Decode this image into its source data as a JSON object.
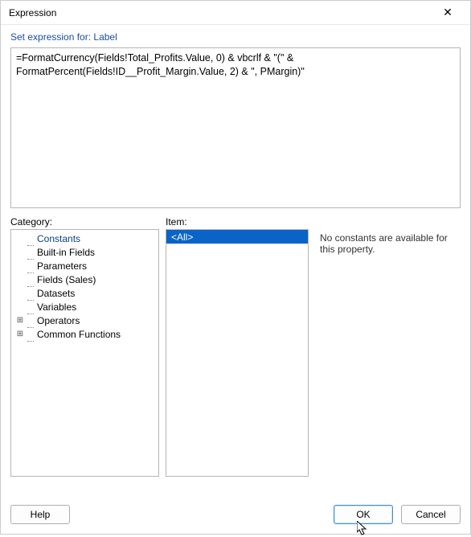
{
  "window": {
    "title": "Expression",
    "close_icon": "✕"
  },
  "header": {
    "prompt_prefix": "Set expression for: ",
    "target": "Label"
  },
  "expression": {
    "text": "=FormatCurrency(Fields!Total_Profits.Value, 0) & vbcrlf & \"(\" & FormatPercent(Fields!ID__Profit_Margin.Value, 2) & \", PMargin)\""
  },
  "labels": {
    "category": "Category:",
    "item": "Item:"
  },
  "category_tree": [
    {
      "label": "Constants",
      "expander": "",
      "selected": true
    },
    {
      "label": "Built-in Fields",
      "expander": "",
      "selected": false
    },
    {
      "label": "Parameters",
      "expander": "",
      "selected": false
    },
    {
      "label": "Fields (Sales)",
      "expander": "",
      "selected": false
    },
    {
      "label": "Datasets",
      "expander": "",
      "selected": false
    },
    {
      "label": "Variables",
      "expander": "",
      "selected": false
    },
    {
      "label": "Operators",
      "expander": "⊞",
      "selected": false
    },
    {
      "label": "Common Functions",
      "expander": "⊞",
      "selected": false
    }
  ],
  "items_list": [
    {
      "label": "<All>",
      "selected": true
    }
  ],
  "description": {
    "text": "No constants are available for this property."
  },
  "buttons": {
    "help": "Help",
    "ok": "OK",
    "cancel": "Cancel"
  }
}
